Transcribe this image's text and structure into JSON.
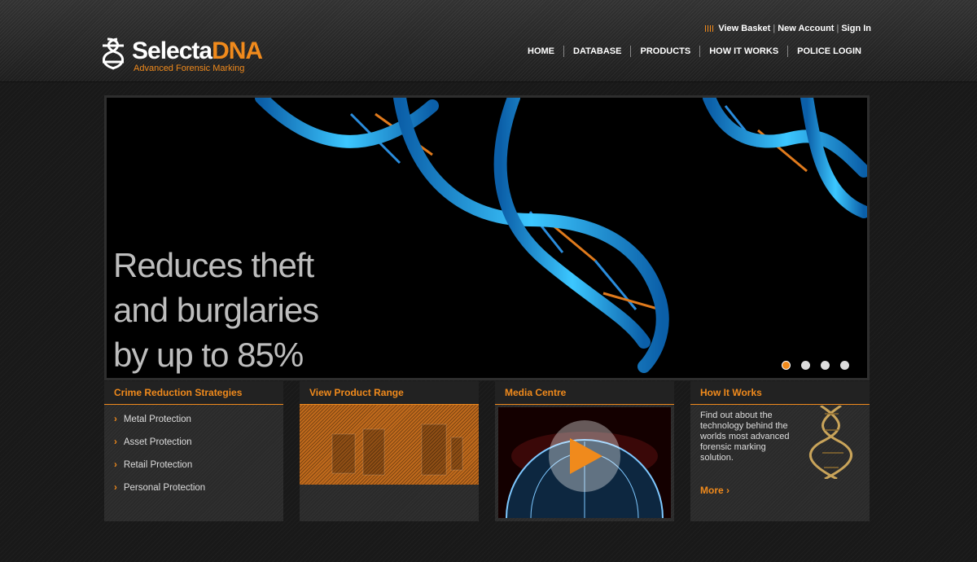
{
  "brand": {
    "name_part1": "Selecta",
    "name_part2": "DNA",
    "tagline": "Advanced Forensic Marking",
    "accent": "#f08a1c"
  },
  "utility_nav": {
    "basket": "View Basket",
    "new_account": "New Account",
    "sign_in": "Sign In",
    "separator": "|"
  },
  "main_nav": [
    "HOME",
    "DATABASE",
    "PRODUCTS",
    "HOW IT WORKS",
    "POLICE LOGIN"
  ],
  "hero": {
    "lines": [
      "Reduces theft",
      "and burglaries",
      "by up to 85%"
    ],
    "slide_count": 4,
    "active_slide": 1
  },
  "panels": {
    "crime": {
      "title": "Crime Reduction Strategies",
      "items": [
        "Metal Protection",
        "Asset Protection",
        "Retail Protection",
        "Personal Protection"
      ]
    },
    "range": {
      "title": "View Product Range"
    },
    "media": {
      "title": "Media Centre"
    },
    "how": {
      "title": "How It Works",
      "text": "Find out about the technology behind the worlds most advanced forensic marking solution.",
      "more": "More"
    }
  },
  "icons": [
    "selectadna-logo-icon",
    "basket-icon",
    "chevron-right-icon",
    "play-icon",
    "dna-helix-icon"
  ]
}
